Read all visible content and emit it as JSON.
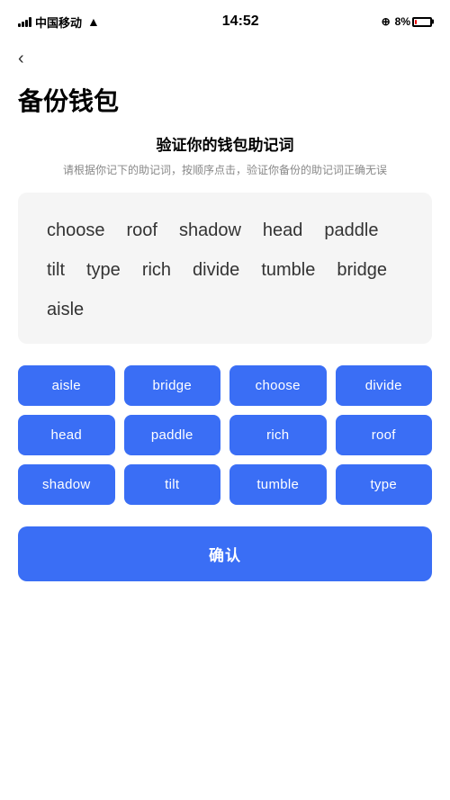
{
  "statusBar": {
    "carrier": "中国移动",
    "time": "14:52",
    "battery": "8%"
  },
  "back": "‹",
  "pageTitle": "备份钱包",
  "sectionTitle": "验证你的钱包助记词",
  "sectionDesc": "请根据你记下的助记词，按顺序点击，验证你备份的助记词正确无误",
  "displayWords": [
    "choose",
    "roof",
    "shadow",
    "head",
    "paddle",
    "tilt",
    "type",
    "rich",
    "divide",
    "tumble",
    "bridge",
    "aisle"
  ],
  "wordButtons": [
    "aisle",
    "bridge",
    "choose",
    "divide",
    "head",
    "paddle",
    "rich",
    "roof",
    "shadow",
    "tilt",
    "tumble",
    "type"
  ],
  "confirmLabel": "确认"
}
